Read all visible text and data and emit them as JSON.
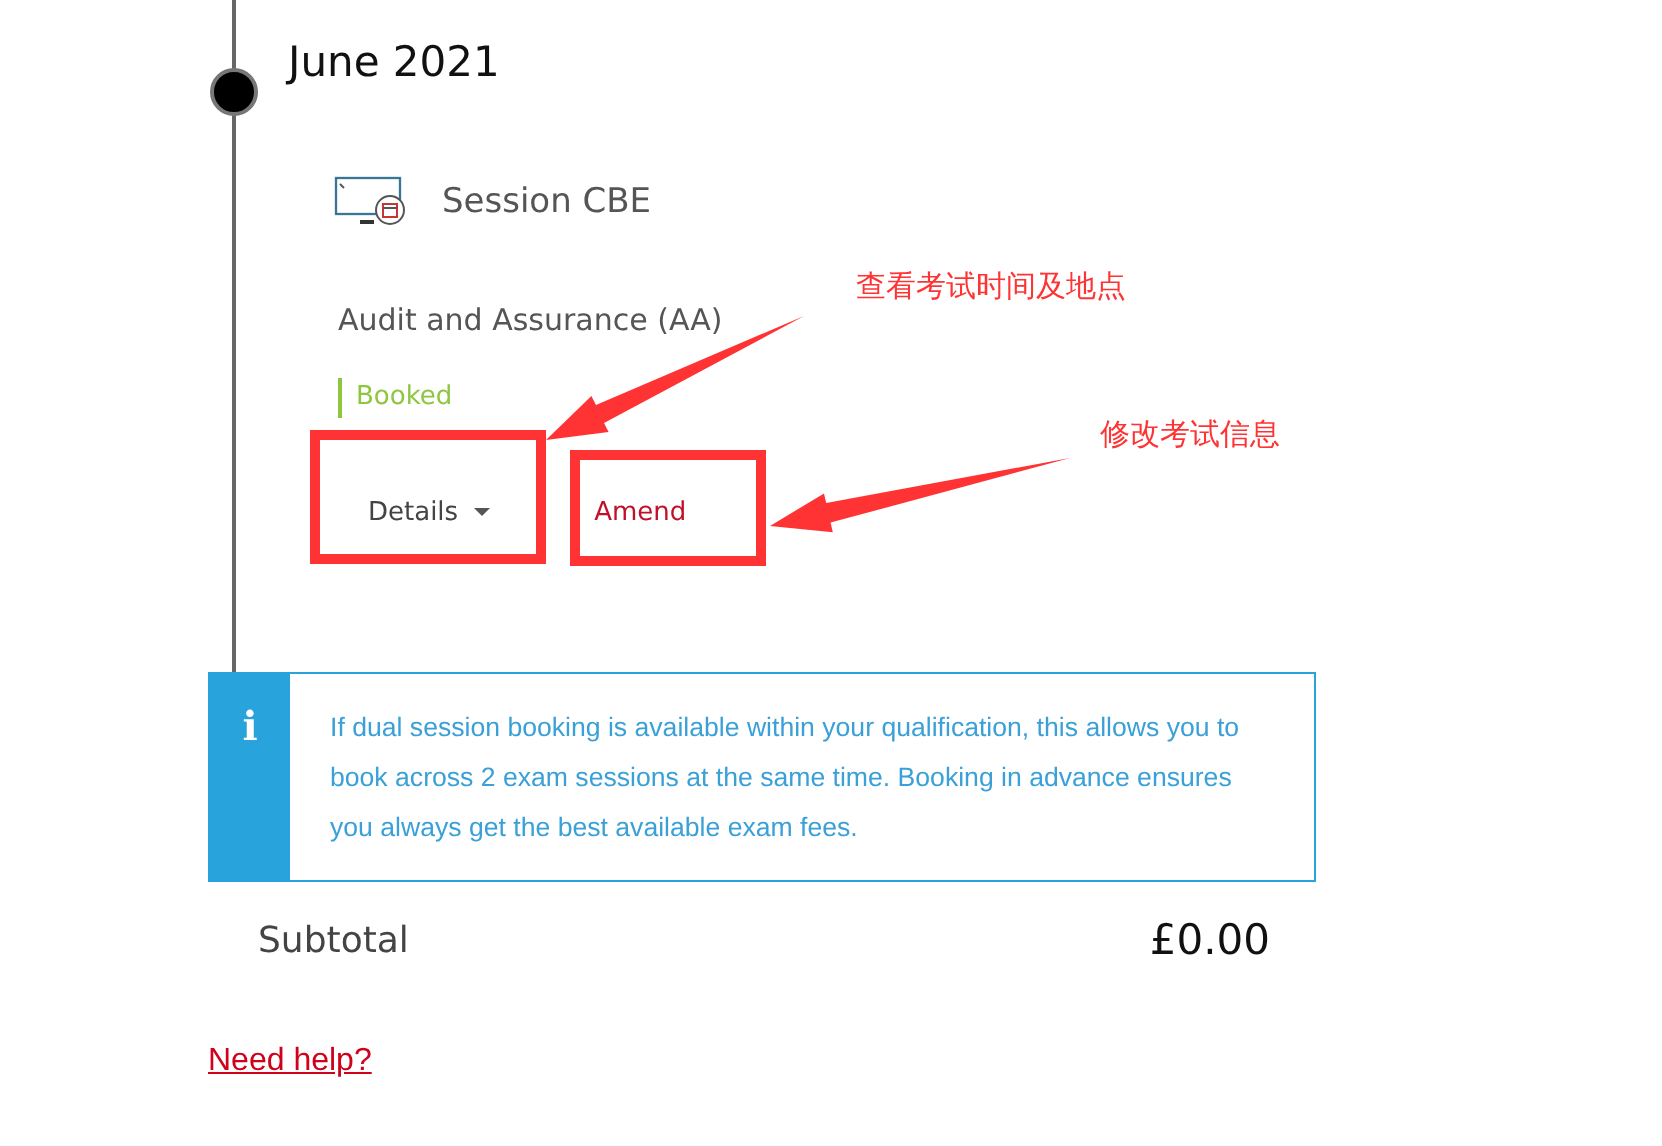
{
  "timeline": {
    "heading": "June 2021",
    "session": {
      "title": "Session CBE"
    },
    "exam": {
      "name": "Audit and Assurance (AA)",
      "status": "Booked"
    },
    "actions": [
      {
        "kind": "dropdown",
        "label": "Details"
      },
      {
        "kind": "link",
        "label": "Amend"
      }
    ],
    "info": {
      "icon": "i",
      "text": "If dual session booking is available within your qualification, this allows you to book across 2 exam sessions at the same time. Booking in advance ensures you always get the best available exam fees."
    }
  },
  "subtotal": {
    "label": "Subtotal",
    "value": "£0.00"
  },
  "help_link": "Need help?",
  "annotations": [
    {
      "text": "查看考试时间及地点"
    },
    {
      "text": "修改考试信息"
    }
  ]
}
